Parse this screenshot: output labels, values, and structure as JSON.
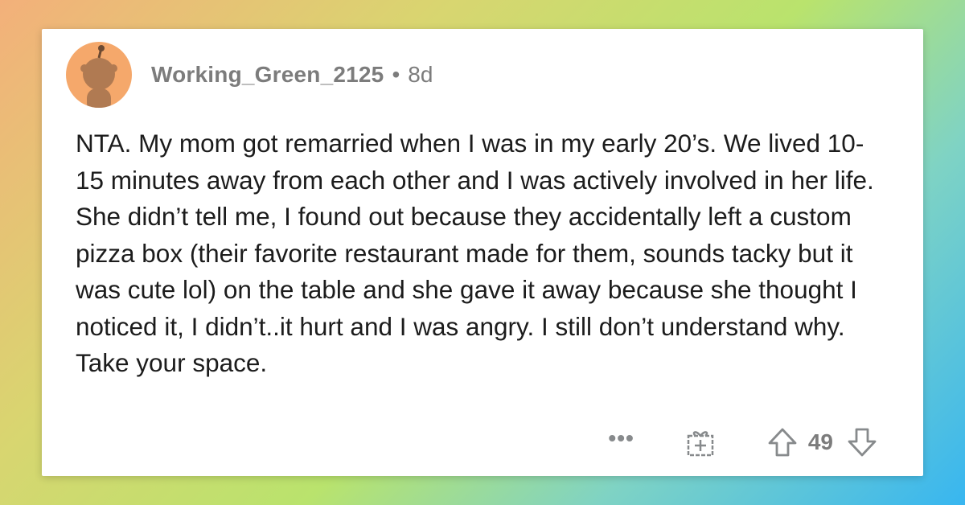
{
  "comment": {
    "author": "Working_Green_2125",
    "separator": "•",
    "age": "8d",
    "body": "NTA. My mom got remarried when I was in my early 20’s. We lived 10-15 minutes away from each other and I was actively involved in her life. She didn’t tell me, I found out because they accidentally left a custom pizza box (their favorite restaurant made for them, sounds tacky but it was cute lol) on the table and she gave it away because she thought I noticed it, I didn’t..it hurt and I was angry. I still don’t understand why. Take your space.",
    "more_label": "•••",
    "score": "49"
  },
  "icons": {
    "avatar": "snoo-avatar-icon",
    "award": "gift-award-icon",
    "upvote": "upvote-arrow-icon",
    "downvote": "downvote-arrow-icon"
  },
  "colors": {
    "avatar_bg": "#f5a86b",
    "meta_text": "#7c7c7c",
    "body_text": "#1c1c1c",
    "action_icons": "#878a8c"
  }
}
